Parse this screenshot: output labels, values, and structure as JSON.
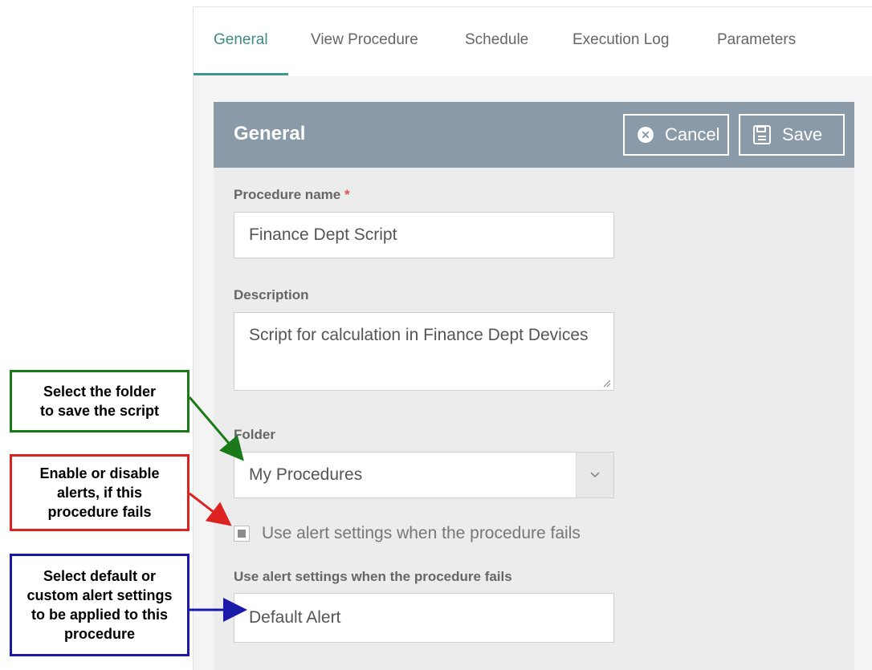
{
  "tabs": [
    {
      "label": "General",
      "active": true
    },
    {
      "label": "View Procedure",
      "active": false
    },
    {
      "label": "Schedule",
      "active": false
    },
    {
      "label": "Execution Log",
      "active": false
    },
    {
      "label": "Parameters",
      "active": false
    }
  ],
  "panel": {
    "title": "General",
    "cancel_label": "Cancel",
    "save_label": "Save",
    "cancel_icon": "circle-x-icon",
    "save_icon": "floppy-disk-icon"
  },
  "form": {
    "procedure_name_label": "Procedure name",
    "required_marker": "*",
    "procedure_name_value": "Finance Dept Script",
    "description_label": "Description",
    "description_value": "Script for calculation in Finance Dept Devices",
    "folder_label": "Folder",
    "folder_value": "My Procedures",
    "alert_checkbox_label": "Use alert settings when the procedure fails",
    "alert_checkbox_checked": "indeterminate",
    "alert_settings_label": "Use alert settings when the procedure fails",
    "alert_settings_value": "Default Alert"
  },
  "callouts": {
    "folder": [
      "Select the folder",
      "to save the script"
    ],
    "alerts": [
      "Enable or disable",
      "alerts, if this",
      "procedure fails"
    ],
    "settings": [
      "Select default or",
      "custom alert settings",
      "to be applied to this",
      "procedure"
    ]
  },
  "colors": {
    "accent": "#3a9a8f",
    "header": "#8a9aa9",
    "callout_green": "#1a7a1a",
    "callout_red": "#dd2222",
    "callout_blue": "#1a1aaa"
  }
}
